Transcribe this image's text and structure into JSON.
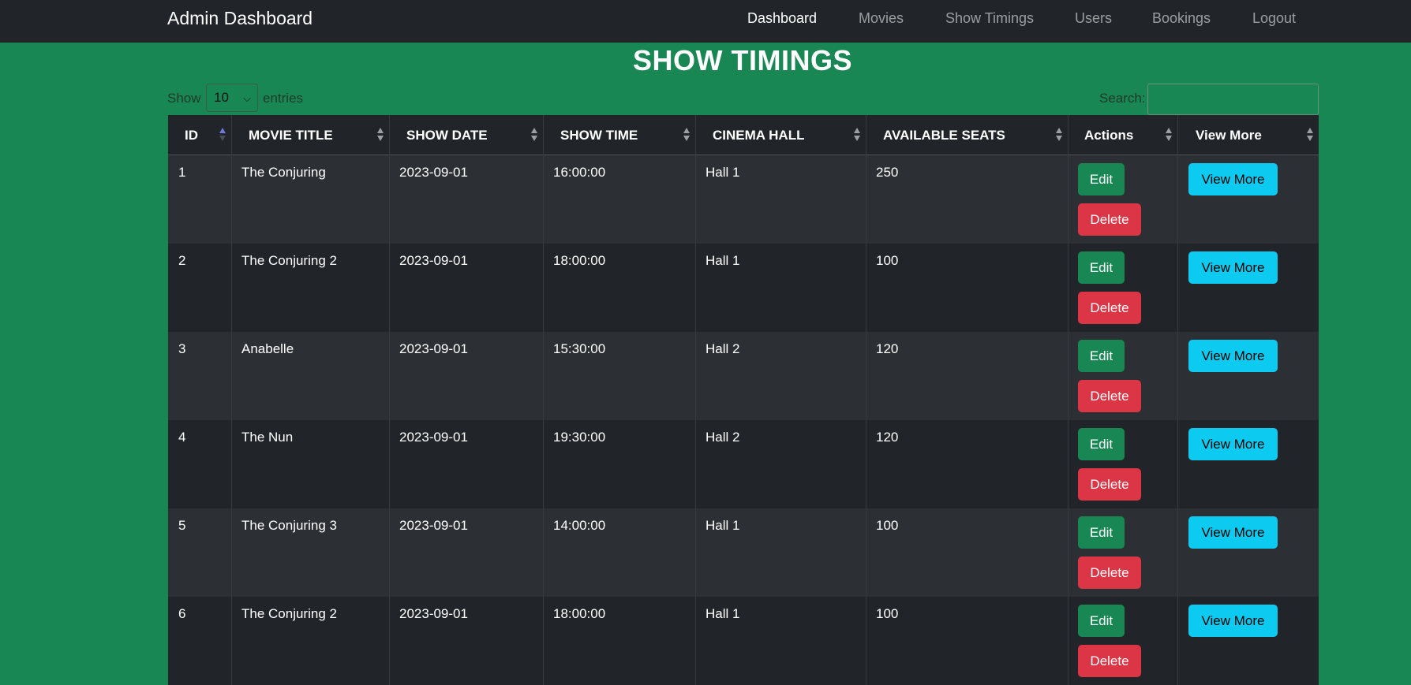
{
  "navbar": {
    "brand": "Admin Dashboard",
    "items": [
      {
        "label": "Dashboard",
        "active": true
      },
      {
        "label": "Movies",
        "active": false
      },
      {
        "label": "Show Timings",
        "active": false
      },
      {
        "label": "Users",
        "active": false
      },
      {
        "label": "Bookings",
        "active": false
      },
      {
        "label": "Logout",
        "active": false
      }
    ]
  },
  "page": {
    "title": "SHOW TIMINGS"
  },
  "length_menu": {
    "show_label": "Show",
    "selected": "10",
    "entries_label": "entries"
  },
  "search": {
    "label": "Search:",
    "value": ""
  },
  "table": {
    "columns": [
      "ID",
      "MOVIE TITLE",
      "SHOW DATE",
      "SHOW TIME",
      "CINEMA HALL",
      "AVAILABLE SEATS",
      "Actions",
      "View More"
    ],
    "sorted_column": "ID",
    "sort_direction": "asc",
    "rows": [
      {
        "id": "1",
        "movie_title": "The Conjuring",
        "show_date": "2023-09-01",
        "show_time": "16:00:00",
        "cinema_hall": "Hall 1",
        "available_seats": "250"
      },
      {
        "id": "2",
        "movie_title": "The Conjuring 2",
        "show_date": "2023-09-01",
        "show_time": "18:00:00",
        "cinema_hall": "Hall 1",
        "available_seats": "100"
      },
      {
        "id": "3",
        "movie_title": "Anabelle",
        "show_date": "2023-09-01",
        "show_time": "15:30:00",
        "cinema_hall": "Hall 2",
        "available_seats": "120"
      },
      {
        "id": "4",
        "movie_title": "The Nun",
        "show_date": "2023-09-01",
        "show_time": "19:30:00",
        "cinema_hall": "Hall 2",
        "available_seats": "120"
      },
      {
        "id": "5",
        "movie_title": "The Conjuring 3",
        "show_date": "2023-09-01",
        "show_time": "14:00:00",
        "cinema_hall": "Hall 1",
        "available_seats": "100"
      },
      {
        "id": "6",
        "movie_title": "The Conjuring 2",
        "show_date": "2023-09-01",
        "show_time": "18:00:00",
        "cinema_hall": "Hall 1",
        "available_seats": "100"
      }
    ],
    "edit_label": "Edit",
    "delete_label": "Delete",
    "view_more_label": "View More"
  },
  "colors": {
    "page_background": "#198754",
    "navbar_background": "#212529",
    "table_dark": "#212529",
    "table_striped": "#2c3034",
    "edit_button": "#198754",
    "delete_button": "#dc3545",
    "view_more_button": "#0dcaf0"
  }
}
